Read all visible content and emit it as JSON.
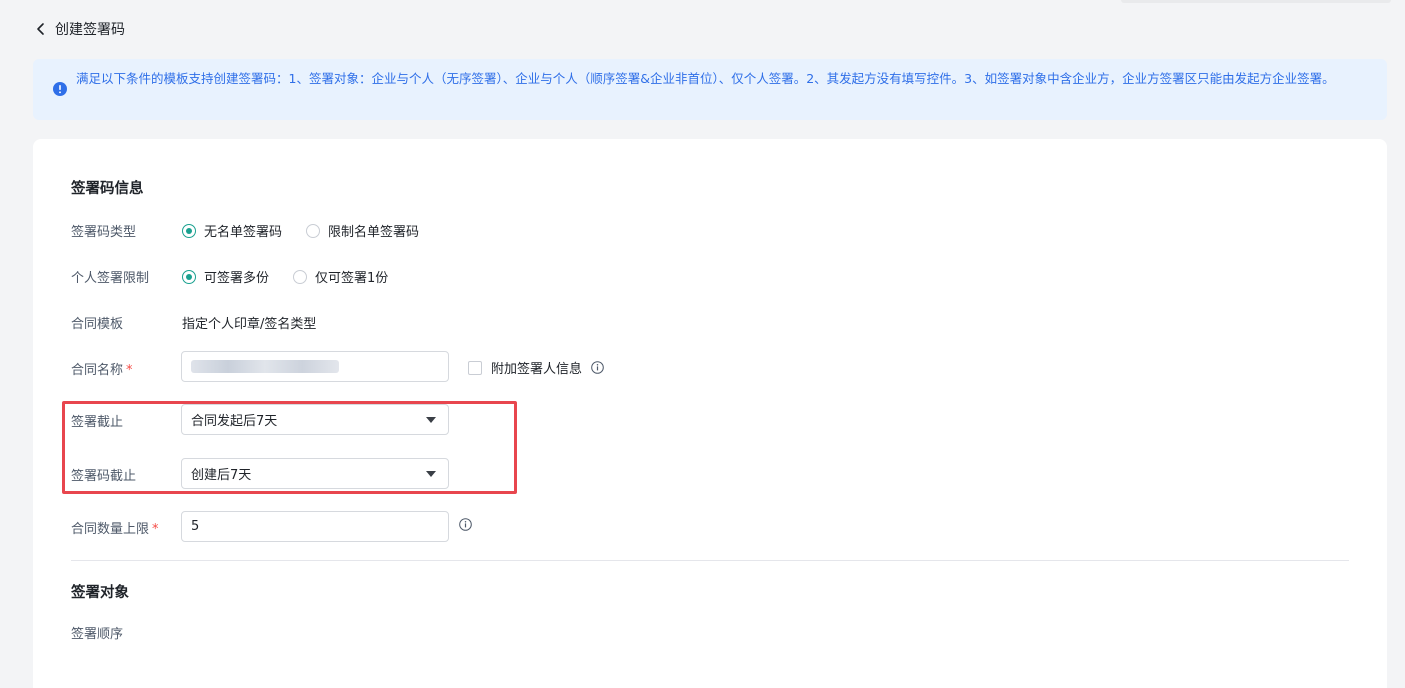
{
  "header": {
    "title": "创建签署码"
  },
  "notice": {
    "text": "满足以下条件的模板支持创建签署码：1、签署对象：企业与个人（无序签署）、企业与个人（顺序签署&企业非首位）、仅个人签署。2、其发起方没有填写控件。3、如签署对象中含企业方，企业方签署区只能由发起方企业签署。"
  },
  "form": {
    "section_info_title": "签署码信息",
    "code_type": {
      "label": "签署码类型",
      "options": [
        "无名单签署码",
        "限制名单签署码"
      ],
      "selected": "无名单签署码"
    },
    "personal_limit": {
      "label": "个人签署限制",
      "options": [
        "可签署多份",
        "仅可签署1份"
      ],
      "selected": "可签署多份"
    },
    "template": {
      "label": "合同模板",
      "value": "指定个人印章/签名类型"
    },
    "contract_name": {
      "label": "合同名称",
      "required_mark": "*",
      "attach_label": "附加签署人信息"
    },
    "sign_deadline": {
      "label": "签署截止",
      "value": "合同发起后7天"
    },
    "code_deadline": {
      "label": "签署码截止",
      "value": "创建后7天"
    },
    "contract_limit": {
      "label": "合同数量上限",
      "required_mark": "*",
      "value": "5"
    },
    "section_target_title": "签署对象",
    "sign_order_label": "签署顺序"
  },
  "colors": {
    "accent": "#1aa190",
    "info": "#2f6fe8",
    "highlight": "#e8464e",
    "required": "#f54a45"
  }
}
